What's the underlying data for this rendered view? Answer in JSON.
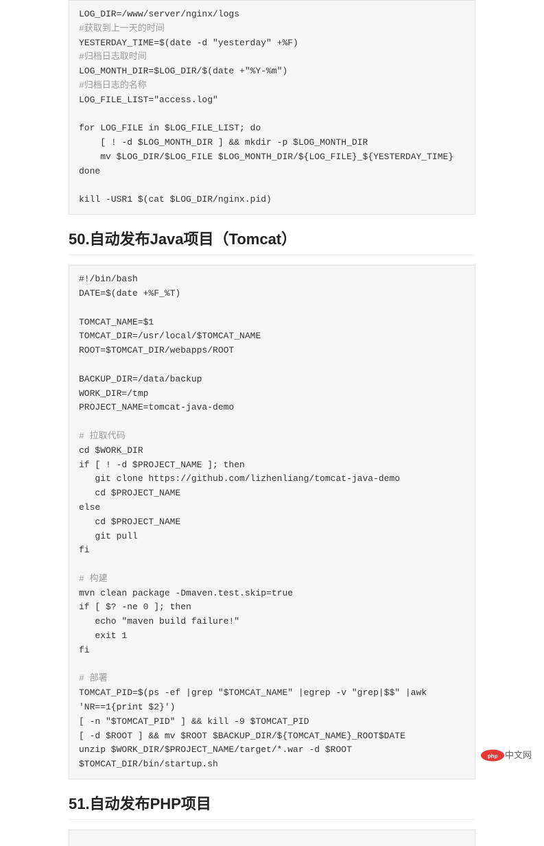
{
  "code1": {
    "l1": "LOG_DIR=/www/server/nginx/logs",
    "c1": "#获取到上一天的时间",
    "l2": "YESTERDAY_TIME=$(date -d \"yesterday\" +%F)",
    "c2": "#归档日志取时间",
    "l3": "LOG_MONTH_DIR=$LOG_DIR/$(date +\"%Y-%m\")",
    "c3": "#归档日志的名称",
    "l4": "LOG_FILE_LIST=\"access.log\"",
    "l5": "for LOG_FILE in $LOG_FILE_LIST; do",
    "l6": "    [ ! -d $LOG_MONTH_DIR ] && mkdir -p $LOG_MONTH_DIR",
    "l7": "    mv $LOG_DIR/$LOG_FILE $LOG_MONTH_DIR/${LOG_FILE}_${YESTERDAY_TIME}",
    "l8": "done",
    "l9": "kill -USR1 $(cat $LOG_DIR/nginx.pid)"
  },
  "heading1": "50.自动发布Java项目（Tomcat）",
  "code2": {
    "l1": "#!/bin/bash",
    "l2": "DATE=$(date +%F_%T)",
    "l3": "TOMCAT_NAME=$1",
    "l4": "TOMCAT_DIR=/usr/local/$TOMCAT_NAME",
    "l5": "ROOT=$TOMCAT_DIR/webapps/ROOT",
    "l6": "BACKUP_DIR=/data/backup",
    "l7": "WORK_DIR=/tmp",
    "l8": "PROJECT_NAME=tomcat-java-demo",
    "c1": "# 拉取代码",
    "l9": "cd $WORK_DIR",
    "l10": "if [ ! -d $PROJECT_NAME ]; then",
    "l11": "   git clone https://github.com/lizhenliang/tomcat-java-demo",
    "l12": "   cd $PROJECT_NAME",
    "l13": "else",
    "l14": "   cd $PROJECT_NAME",
    "l15": "   git pull",
    "l16": "fi",
    "c2": "# 构建",
    "l17": "mvn clean package -Dmaven.test.skip=true",
    "l18": "if [ $? -ne 0 ]; then",
    "l19": "   echo \"maven build failure!\"",
    "l20": "   exit 1",
    "l21": "fi",
    "c3": "# 部署",
    "l22": "TOMCAT_PID=$(ps -ef |grep \"$TOMCAT_NAME\" |egrep -v \"grep|$$\" |awk 'NR==1{print $2}')",
    "l23": "[ -n \"$TOMCAT_PID\" ] && kill -9 $TOMCAT_PID",
    "l24": "[ -d $ROOT ] && mv $ROOT $BACKUP_DIR/${TOMCAT_NAME}_ROOT$DATE",
    "l25": "unzip $WORK_DIR/$PROJECT_NAME/target/*.war -d $ROOT",
    "l26": "$TOMCAT_DIR/bin/startup.sh"
  },
  "heading2": "51.自动发布PHP项目",
  "brand_text": "中文网"
}
